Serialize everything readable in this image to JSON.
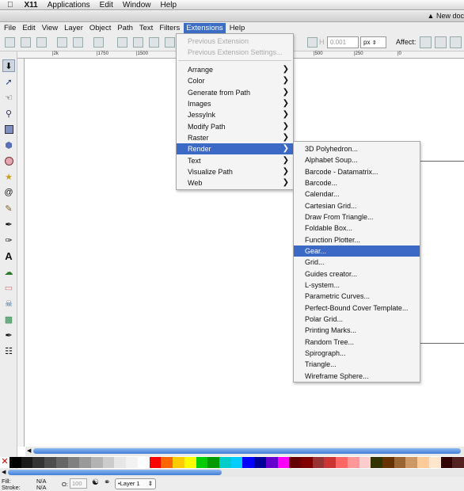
{
  "mac_menubar": {
    "apple": "",
    "app": "X11",
    "items": [
      "Applications",
      "Edit",
      "Window",
      "Help"
    ]
  },
  "window": {
    "title": "New doc"
  },
  "app_menu": {
    "items": [
      "File",
      "Edit",
      "View",
      "Layer",
      "Object",
      "Path",
      "Text",
      "Filters",
      "Extensions",
      "Help"
    ],
    "active": "Extensions"
  },
  "toolbar": {
    "x_value": "0.001",
    "unit": "px",
    "affect_label": "Affect:"
  },
  "ruler": {
    "labels": [
      "|2k",
      "|1750",
      "|1500",
      "|500",
      "|250",
      "|0"
    ]
  },
  "extensions_menu": {
    "items": [
      {
        "label": "Previous Extension",
        "disabled": true
      },
      {
        "label": "Previous Extension Settings...",
        "disabled": true
      },
      {
        "label": "Arrange",
        "submenu": true
      },
      {
        "label": "Color",
        "submenu": true
      },
      {
        "label": "Generate from Path",
        "submenu": true
      },
      {
        "label": "Images",
        "submenu": true
      },
      {
        "label": "JessyInk",
        "submenu": true
      },
      {
        "label": "Modify Path",
        "submenu": true
      },
      {
        "label": "Raster",
        "submenu": true
      },
      {
        "label": "Render",
        "submenu": true,
        "selected": true
      },
      {
        "label": "Text",
        "submenu": true
      },
      {
        "label": "Visualize Path",
        "submenu": true
      },
      {
        "label": "Web",
        "submenu": true
      }
    ]
  },
  "render_submenu": {
    "items": [
      "3D Polyhedron...",
      "Alphabet Soup...",
      "Barcode - Datamatrix...",
      "Barcode...",
      "Calendar...",
      "Cartesian Grid...",
      "Draw From Triangle...",
      "Foldable Box...",
      "Function Plotter...",
      "Gear...",
      "Grid...",
      "Guides creator...",
      "L-system...",
      "Parametric Curves...",
      "Perfect-Bound Cover Template...",
      "Polar Grid...",
      "Printing Marks...",
      "Random Tree...",
      "Spirograph...",
      "Triangle...",
      "Wireframe Sphere..."
    ],
    "selected": "Gear..."
  },
  "status": {
    "fill_label": "Fill:",
    "fill_value": "N/A",
    "stroke_label": "Stroke:",
    "stroke_value": "N/A",
    "opacity_label": "O:",
    "opacity_value": "100",
    "layer": "•Layer 1"
  },
  "palette": [
    "#000000",
    "#1a1a1a",
    "#333333",
    "#4d4d4d",
    "#666666",
    "#808080",
    "#999999",
    "#b3b3b3",
    "#cccccc",
    "#e6e6e6",
    "#f2f2f2",
    "#ffffff",
    "#ff0000",
    "#ff6600",
    "#ffcc00",
    "#ffff00",
    "#00cc00",
    "#009900",
    "#00cccc",
    "#00ccff",
    "#0000ff",
    "#000099",
    "#6600cc",
    "#ff00ff",
    "#660000",
    "#800000",
    "#993333",
    "#cc3333",
    "#ff6666",
    "#ff9999",
    "#ffcccc",
    "#333300",
    "#663300",
    "#996633",
    "#cc9966",
    "#ffcc99",
    "#ffe6cc",
    "#330000",
    "#552222"
  ]
}
